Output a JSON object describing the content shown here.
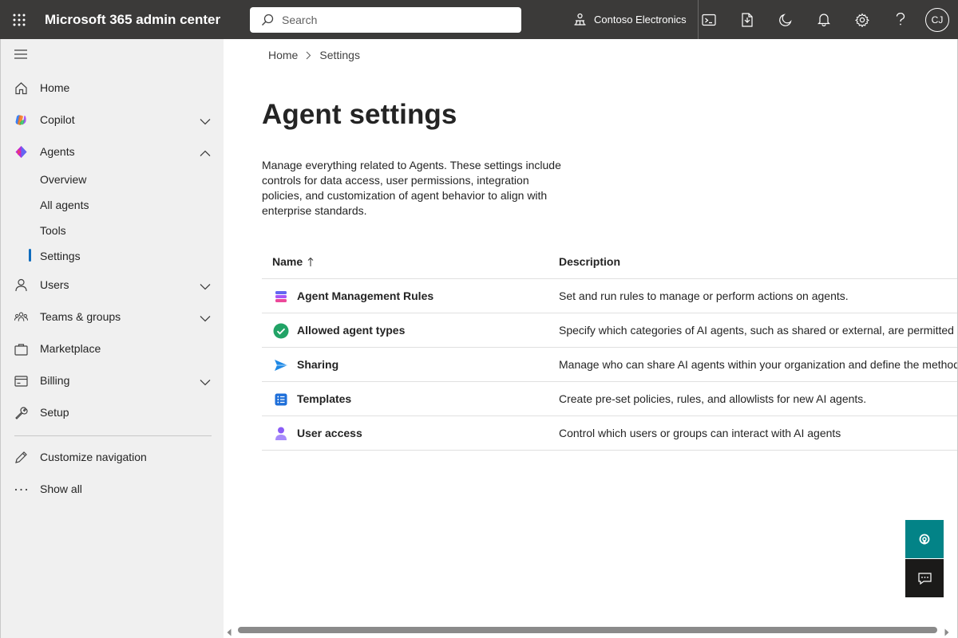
{
  "header": {
    "app_title": "Microsoft 365 admin center",
    "search_placeholder": "Search",
    "org_name": "Contoso Electronics",
    "user_initials": "CJ",
    "icons": [
      "waffle-icon",
      "search-icon",
      "org-icon",
      "terminal-icon",
      "document-icon",
      "dark-mode-icon",
      "bell-icon",
      "gear-icon",
      "help-icon"
    ]
  },
  "sidebar": {
    "items": [
      {
        "label": "Home",
        "icon": "home-icon"
      },
      {
        "label": "Copilot",
        "icon": "copilot-icon",
        "expandable": true
      },
      {
        "label": "Agents",
        "icon": "agents-icon",
        "expanded": true
      },
      {
        "label": "Users",
        "icon": "user-icon",
        "expandable": true
      },
      {
        "label": "Teams & groups",
        "icon": "teams-icon",
        "expandable": true
      },
      {
        "label": "Marketplace",
        "icon": "marketplace-icon"
      },
      {
        "label": "Billing",
        "icon": "billing-icon",
        "expandable": true
      },
      {
        "label": "Setup",
        "icon": "wrench-icon"
      },
      {
        "label": "Customize navigation",
        "icon": "pencil-icon"
      },
      {
        "label": "Show all",
        "icon": "ellipsis-icon"
      }
    ],
    "agents_sub": [
      "Overview",
      "All agents",
      "Tools",
      "Settings"
    ],
    "active_sub": "Settings"
  },
  "breadcrumb": [
    "Home",
    "Settings"
  ],
  "page": {
    "title": "Agent settings",
    "description": "Manage everything related to Agents. These settings include controls for data access, user permissions, integration policies, and customization of agent behavior to align with enterprise standards."
  },
  "table": {
    "headers": {
      "name": "Name",
      "description": "Description",
      "sort_icon": "arrow-up-icon"
    },
    "rows": [
      {
        "name": "Agent Management Rules",
        "description": "Set and run rules to manage or perform actions on agents.",
        "icon": "rules-icon"
      },
      {
        "name": "Allowed agent types",
        "description": "Specify which categories of AI agents, such as shared or external, are permitted for use",
        "icon": "check-circle-icon"
      },
      {
        "name": "Sharing",
        "description": "Manage who can share AI agents within your organization and define the methods of sharing",
        "icon": "send-icon"
      },
      {
        "name": "Templates",
        "description": "Create pre-set policies, rules, and allowlists for new AI agents.",
        "icon": "list-icon"
      },
      {
        "name": "User access",
        "description": "Control which users or groups can interact with AI agents",
        "icon": "person-icon"
      }
    ]
  },
  "colors": {
    "topbar": "#3b3a39",
    "sidebar": "#f0f0f0",
    "accent": "#0f6cbd",
    "help_button": "#038387",
    "feedback_button": "#1b1a19"
  }
}
